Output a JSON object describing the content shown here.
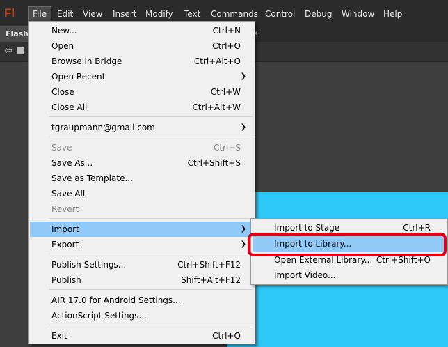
{
  "app": {
    "logo": "Fl"
  },
  "menubar": {
    "items": [
      "File",
      "Edit",
      "View",
      "Insert",
      "Modify",
      "Text",
      "Commands",
      "Control",
      "Debug",
      "Window",
      "Help"
    ],
    "active": "File"
  },
  "document": {
    "tab_label": "FlashV"
  },
  "file_menu": {
    "items": [
      {
        "label": "New...",
        "shortcut": "Ctrl+N"
      },
      {
        "label": "Open",
        "shortcut": "Ctrl+O"
      },
      {
        "label": "Browse in Bridge",
        "shortcut": "Ctrl+Alt+O"
      },
      {
        "label": "Open Recent",
        "shortcut": ""
      },
      {
        "label": "Close",
        "shortcut": "Ctrl+W"
      },
      {
        "label": "Close All",
        "shortcut": "Ctrl+Alt+W"
      },
      {
        "label": "tgraupmann@gmail.com",
        "shortcut": ""
      },
      {
        "label": "Save",
        "shortcut": "Ctrl+S"
      },
      {
        "label": "Save As...",
        "shortcut": "Ctrl+Shift+S"
      },
      {
        "label": "Save as Template...",
        "shortcut": ""
      },
      {
        "label": "Save All",
        "shortcut": ""
      },
      {
        "label": "Revert",
        "shortcut": ""
      },
      {
        "label": "Import",
        "shortcut": ""
      },
      {
        "label": "Export",
        "shortcut": ""
      },
      {
        "label": "Publish Settings...",
        "shortcut": "Ctrl+Shift+F12"
      },
      {
        "label": "Publish",
        "shortcut": "Shift+Alt+F12"
      },
      {
        "label": "AIR 17.0 for Android Settings...",
        "shortcut": ""
      },
      {
        "label": "ActionScript Settings...",
        "shortcut": ""
      },
      {
        "label": "Exit",
        "shortcut": "Ctrl+Q"
      }
    ]
  },
  "import_submenu": {
    "items": [
      {
        "label": "Import to Stage",
        "shortcut": "Ctrl+R"
      },
      {
        "label": "Import to Library...",
        "shortcut": ""
      },
      {
        "label": "Open External Library...",
        "shortcut": "Ctrl+Shift+O"
      },
      {
        "label": "Import Video...",
        "shortcut": ""
      }
    ]
  },
  "colors": {
    "menubar_bg": "#2b2b2b",
    "menu_bg": "#f0f0f0",
    "highlight": "#91c9f7",
    "stage": "#2ec8f8",
    "callout": "#e3001b"
  }
}
